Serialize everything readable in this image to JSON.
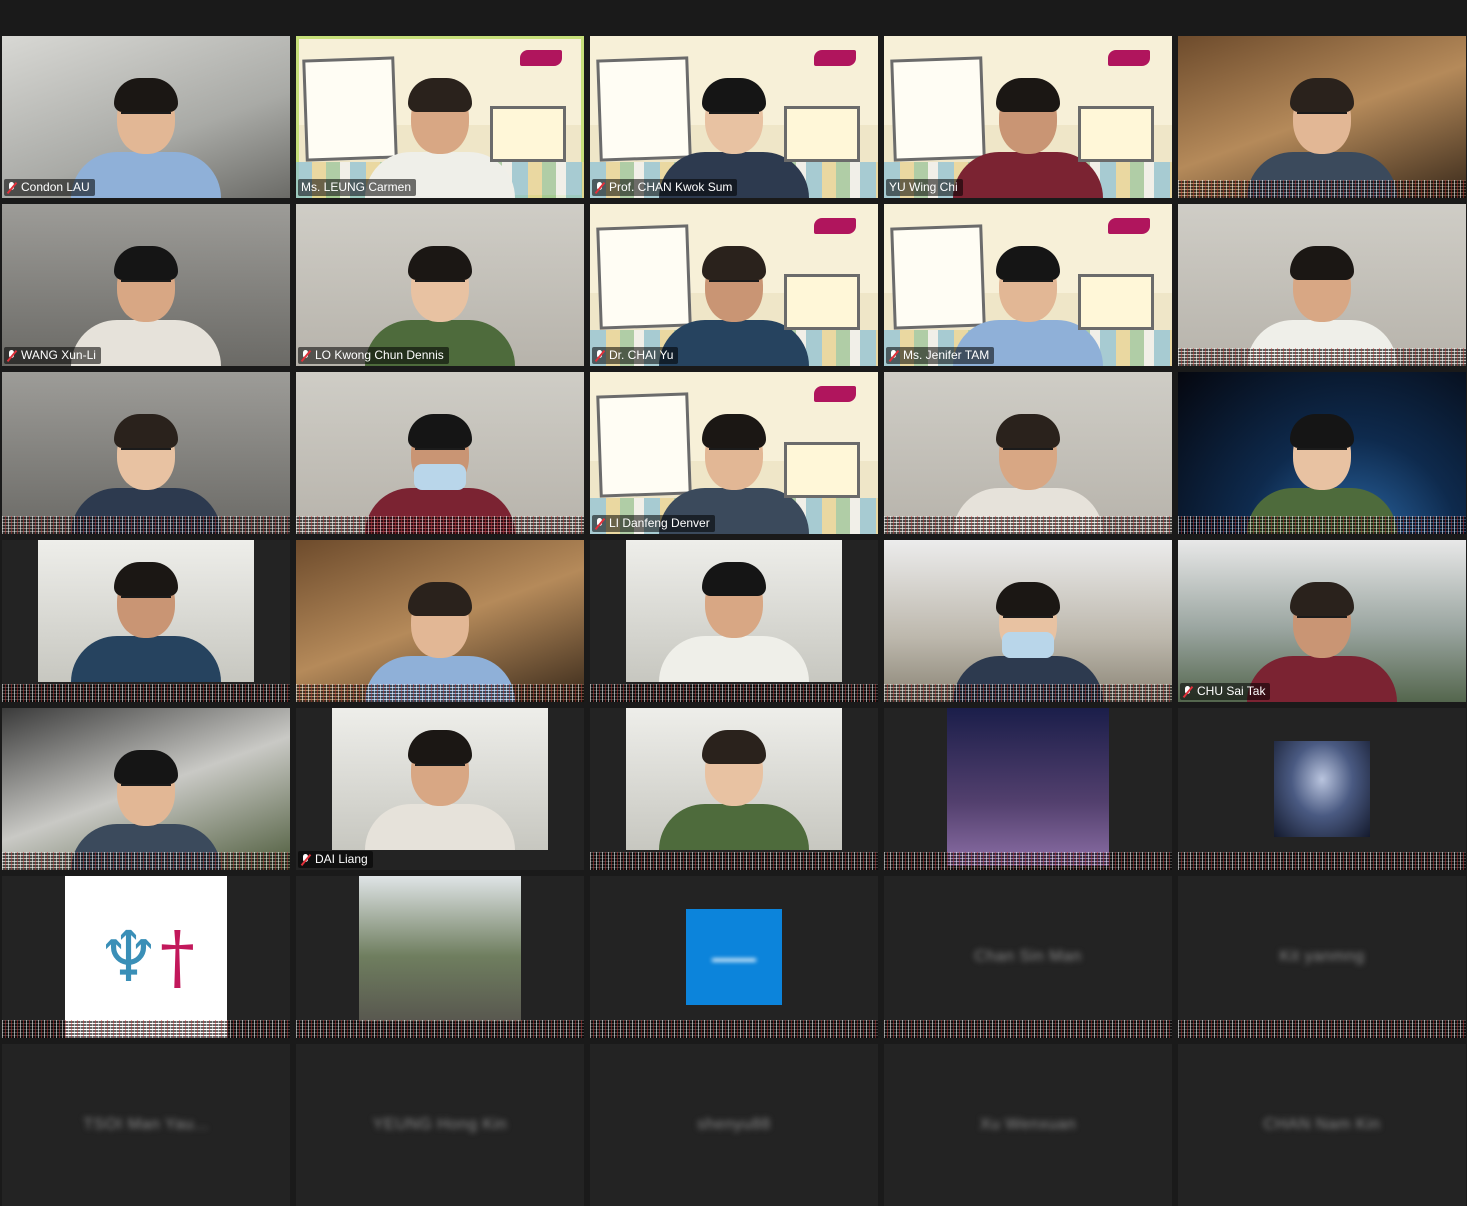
{
  "meeting": {
    "tiles": [
      {
        "name": "Condon LAU",
        "bg": "office",
        "muted": true,
        "person": "glasses"
      },
      {
        "name": "Ms. LEUNG Carmen",
        "bg": "cityu",
        "muted": false,
        "active": true,
        "person": "plain"
      },
      {
        "name": "Prof. CHAN Kwok Sum",
        "bg": "cityu",
        "muted": true,
        "person": "glasses"
      },
      {
        "name": "YU Wing Chi",
        "bg": "cityu",
        "muted": false,
        "person": "plain"
      },
      {
        "name": "",
        "bg": "warm",
        "muted": true,
        "noise": true,
        "person": "glasses"
      },
      {
        "name": "WANG Xun-Li",
        "bg": "room",
        "muted": true,
        "person": "glasses"
      },
      {
        "name": "LO Kwong Chun Dennis",
        "bg": "wall",
        "muted": true,
        "person": "glasses"
      },
      {
        "name": "Dr. CHAI Yu",
        "bg": "cityu",
        "muted": true,
        "person": "glasses"
      },
      {
        "name": "Ms. Jenifer TAM",
        "bg": "cityu",
        "muted": true,
        "person": "glasses"
      },
      {
        "name": "",
        "bg": "wall",
        "muted": true,
        "noise": true,
        "person": "plain"
      },
      {
        "name": "",
        "bg": "room",
        "muted": true,
        "noise": true,
        "person": "glasses"
      },
      {
        "name": "",
        "bg": "wall",
        "muted": true,
        "noise": true,
        "person": "mask"
      },
      {
        "name": "LI Danfeng Denver",
        "bg": "cityu",
        "muted": true,
        "person": "glasses"
      },
      {
        "name": "",
        "bg": "wall",
        "muted": true,
        "noise": true,
        "person": "glasses"
      },
      {
        "name": "",
        "bg": "space",
        "muted": true,
        "noise": true,
        "person": "glasses"
      },
      {
        "name": "",
        "bg": "dark",
        "muted": true,
        "noise": true,
        "inset": "white",
        "person": "glasses"
      },
      {
        "name": "",
        "bg": "warm",
        "muted": true,
        "noise": true,
        "person": "plain"
      },
      {
        "name": "",
        "bg": "dark",
        "muted": false,
        "noise": true,
        "inset": "white",
        "person": "plain"
      },
      {
        "name": "",
        "bg": "library",
        "muted": true,
        "noise": true,
        "person": "mask"
      },
      {
        "name": "CHU Sai Tak",
        "bg": "campus",
        "muted": true,
        "person": "glasses"
      },
      {
        "name": "",
        "bg": "car",
        "muted": true,
        "noise": true,
        "person": "glasses"
      },
      {
        "name": "DAI Liang",
        "bg": "dark",
        "muted": true,
        "inset": "white",
        "person": "glasses"
      },
      {
        "name": "",
        "bg": "dark",
        "muted": true,
        "noise": true,
        "inset": "white",
        "person": "plain"
      },
      {
        "name": "",
        "bg": "dark",
        "muted": true,
        "noise": true,
        "inset": "night"
      },
      {
        "name": "",
        "bg": "dark",
        "muted": true,
        "noise": true,
        "inset": "galaxy"
      },
      {
        "name": "",
        "bg": "dark",
        "muted": true,
        "noise": true,
        "inset": "logo"
      },
      {
        "name": "",
        "bg": "dark",
        "muted": true,
        "noise": true,
        "inset": "street"
      },
      {
        "name": "",
        "bg": "dark",
        "muted": true,
        "noise": true,
        "inset": "blue"
      },
      {
        "name": "",
        "bg": "dark",
        "muted": true,
        "noise": true,
        "blurred": "Chan Sin Man"
      },
      {
        "name": "",
        "bg": "dark",
        "muted": true,
        "noise": true,
        "blurred": "Kit yanmng"
      },
      {
        "name": "",
        "bg": "dark",
        "muted": false,
        "blurred": "TSOI Man Yau..."
      },
      {
        "name": "",
        "bg": "dark",
        "muted": false,
        "blurred": "YEUNG Hong Kin"
      },
      {
        "name": "",
        "bg": "dark",
        "muted": false,
        "blurred": "shenyu88"
      },
      {
        "name": "",
        "bg": "dark",
        "muted": false,
        "blurred": "Xu Wenxuan"
      },
      {
        "name": "",
        "bg": "dark",
        "muted": false,
        "blurred": "CHAN Nam Kin"
      }
    ]
  },
  "colors": {
    "active_border": "#c7e07a",
    "muted_mic": "#e0303a",
    "background": "#1a1a1a"
  },
  "icons": {
    "muted": "mic-muted-icon"
  }
}
